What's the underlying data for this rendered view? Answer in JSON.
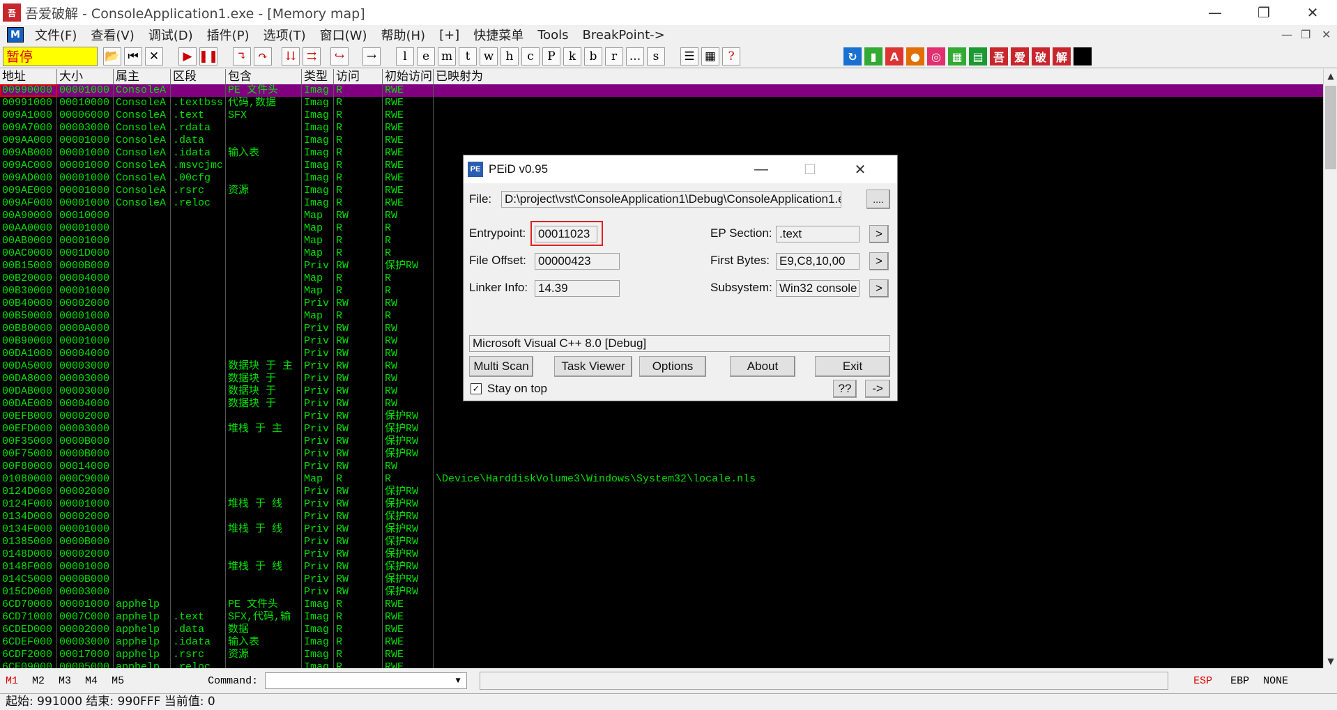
{
  "window": {
    "title": "吾爱破解 - ConsoleApplication1.exe - [Memory map]",
    "app_icon_glyph": "吾"
  },
  "menu": {
    "logo": "M",
    "items": [
      "文件(F)",
      "查看(V)",
      "调试(D)",
      "插件(P)",
      "选项(T)",
      "窗口(W)",
      "帮助(H)",
      "[+]",
      "快捷菜单",
      "Tools",
      "BreakPoint->"
    ]
  },
  "toolbar": {
    "status": "暂停",
    "letters": [
      "l",
      "e",
      "m",
      "t",
      "w",
      "h",
      "c",
      "P",
      "k",
      "b",
      "r",
      "...",
      "s"
    ],
    "chinese_buttons": [
      "吾",
      "爱",
      "破",
      "解"
    ]
  },
  "memory_map": {
    "columns": [
      "地址",
      "大小",
      "属主",
      "区段",
      "包含",
      "类型",
      "访问",
      "初始访问",
      "已映射为"
    ],
    "rows": [
      [
        "00990000",
        "00001000",
        "ConsoleA",
        "",
        "PE 文件头",
        "Imag",
        "R",
        "RWE",
        ""
      ],
      [
        "00991000",
        "00010000",
        "ConsoleA",
        ".textbss",
        "代码,数据",
        "Imag",
        "R",
        "RWE",
        ""
      ],
      [
        "009A1000",
        "00006000",
        "ConsoleA",
        ".text",
        "SFX",
        "Imag",
        "R",
        "RWE",
        ""
      ],
      [
        "009A7000",
        "00003000",
        "ConsoleA",
        ".rdata",
        "",
        "Imag",
        "R",
        "RWE",
        ""
      ],
      [
        "009AA000",
        "00001000",
        "ConsoleA",
        ".data",
        "",
        "Imag",
        "R",
        "RWE",
        ""
      ],
      [
        "009AB000",
        "00001000",
        "ConsoleA",
        ".idata",
        "输入表",
        "Imag",
        "R",
        "RWE",
        ""
      ],
      [
        "009AC000",
        "00001000",
        "ConsoleA",
        ".msvcjmc",
        "",
        "Imag",
        "R",
        "RWE",
        ""
      ],
      [
        "009AD000",
        "00001000",
        "ConsoleA",
        ".00cfg",
        "",
        "Imag",
        "R",
        "RWE",
        ""
      ],
      [
        "009AE000",
        "00001000",
        "ConsoleA",
        ".rsrc",
        "资源",
        "Imag",
        "R",
        "RWE",
        ""
      ],
      [
        "009AF000",
        "00001000",
        "ConsoleA",
        ".reloc",
        "",
        "Imag",
        "R",
        "RWE",
        ""
      ],
      [
        "00A90000",
        "00010000",
        "",
        "",
        "",
        "Map",
        "RW",
        "RW",
        ""
      ],
      [
        "00AA0000",
        "00001000",
        "",
        "",
        "",
        "Map",
        "R",
        "R",
        ""
      ],
      [
        "00AB0000",
        "00001000",
        "",
        "",
        "",
        "Map",
        "R",
        "R",
        ""
      ],
      [
        "00AC0000",
        "0001D000",
        "",
        "",
        "",
        "Map",
        "R",
        "R",
        ""
      ],
      [
        "00B15000",
        "0000B000",
        "",
        "",
        "",
        "Priv",
        "RW",
        "保护RW",
        ""
      ],
      [
        "00B20000",
        "00004000",
        "",
        "",
        "",
        "Map",
        "R",
        "R",
        ""
      ],
      [
        "00B30000",
        "00001000",
        "",
        "",
        "",
        "Map",
        "R",
        "R",
        ""
      ],
      [
        "00B40000",
        "00002000",
        "",
        "",
        "",
        "Priv",
        "RW",
        "RW",
        ""
      ],
      [
        "00B50000",
        "00001000",
        "",
        "",
        "",
        "Map",
        "R",
        "R",
        ""
      ],
      [
        "00B80000",
        "0000A000",
        "",
        "",
        "",
        "Priv",
        "RW",
        "RW",
        ""
      ],
      [
        "00B90000",
        "00001000",
        "",
        "",
        "",
        "Priv",
        "RW",
        "RW",
        ""
      ],
      [
        "00DA1000",
        "00004000",
        "",
        "",
        "",
        "Priv",
        "RW",
        "RW",
        ""
      ],
      [
        "00DA5000",
        "00003000",
        "",
        "",
        "数据块 于 主",
        "Priv",
        "RW",
        "RW",
        ""
      ],
      [
        "00DA8000",
        "00003000",
        "",
        "",
        "数据块 于",
        "Priv",
        "RW",
        "RW",
        ""
      ],
      [
        "00DAB000",
        "00003000",
        "",
        "",
        "数据块 于",
        "Priv",
        "RW",
        "RW",
        ""
      ],
      [
        "00DAE000",
        "00004000",
        "",
        "",
        "数据块 于",
        "Priv",
        "RW",
        "RW",
        ""
      ],
      [
        "00EFB000",
        "00002000",
        "",
        "",
        "",
        "Priv",
        "RW",
        "保护RW",
        ""
      ],
      [
        "00EFD000",
        "00003000",
        "",
        "",
        "堆栈 于 主",
        "Priv",
        "RW",
        "保护RW",
        ""
      ],
      [
        "00F35000",
        "0000B000",
        "",
        "",
        "",
        "Priv",
        "RW",
        "保护RW",
        ""
      ],
      [
        "00F75000",
        "0000B000",
        "",
        "",
        "",
        "Priv",
        "RW",
        "保护RW",
        ""
      ],
      [
        "00F80000",
        "00014000",
        "",
        "",
        "",
        "Priv",
        "RW",
        "RW",
        ""
      ],
      [
        "01080000",
        "000C9000",
        "",
        "",
        "",
        "Map",
        "R",
        "R",
        "\\Device\\HarddiskVolume3\\Windows\\System32\\locale.nls"
      ],
      [
        "0124D000",
        "00002000",
        "",
        "",
        "",
        "Priv",
        "RW",
        "保护RW",
        ""
      ],
      [
        "0124F000",
        "00001000",
        "",
        "",
        "堆栈 于 线",
        "Priv",
        "RW",
        "保护RW",
        ""
      ],
      [
        "0134D000",
        "00002000",
        "",
        "",
        "",
        "Priv",
        "RW",
        "保护RW",
        ""
      ],
      [
        "0134F000",
        "00001000",
        "",
        "",
        "堆栈 于 线",
        "Priv",
        "RW",
        "保护RW",
        ""
      ],
      [
        "01385000",
        "0000B000",
        "",
        "",
        "",
        "Priv",
        "RW",
        "保护RW",
        ""
      ],
      [
        "0148D000",
        "00002000",
        "",
        "",
        "",
        "Priv",
        "RW",
        "保护RW",
        ""
      ],
      [
        "0148F000",
        "00001000",
        "",
        "",
        "堆栈 于 线",
        "Priv",
        "RW",
        "保护RW",
        ""
      ],
      [
        "014C5000",
        "0000B000",
        "",
        "",
        "",
        "Priv",
        "RW",
        "保护RW",
        ""
      ],
      [
        "015CD000",
        "00003000",
        "",
        "",
        "",
        "Priv",
        "RW",
        "保护RW",
        ""
      ],
      [
        "6CD70000",
        "00001000",
        "apphelp",
        "",
        "PE 文件头",
        "Imag",
        "R",
        "RWE",
        ""
      ],
      [
        "6CD71000",
        "0007C000",
        "apphelp",
        ".text",
        "SFX,代码,输",
        "Imag",
        "R",
        "RWE",
        ""
      ],
      [
        "6CDED000",
        "00002000",
        "apphelp",
        ".data",
        "数据",
        "Imag",
        "R",
        "RWE",
        ""
      ],
      [
        "6CDEF000",
        "00003000",
        "apphelp",
        ".idata",
        "输入表",
        "Imag",
        "R",
        "RWE",
        ""
      ],
      [
        "6CDF2000",
        "00017000",
        "apphelp",
        ".rsrc",
        "资源",
        "Imag",
        "R",
        "RWE",
        ""
      ],
      [
        "6CE09000",
        "00005000",
        "apphelp",
        ".reloc",
        "",
        "Imag",
        "R",
        "RWE",
        ""
      ]
    ]
  },
  "command_bar": {
    "tabs": [
      "M1",
      "M2",
      "M3",
      "M4",
      "M5"
    ],
    "label": "Command:",
    "registers": [
      "ESP",
      "EBP",
      "NONE"
    ]
  },
  "status_bar": "起始: 991000 结束: 990FFF 当前值: 0",
  "peid": {
    "title": "PEiD v0.95",
    "file_label": "File:",
    "file_value": "D:\\project\\vst\\ConsoleApplication1\\Debug\\ConsoleApplication1.exe",
    "browse": "....",
    "entrypoint_label": "Entrypoint:",
    "entrypoint": "00011023",
    "file_offset_label": "File Offset:",
    "file_offset": "00000423",
    "linker_label": "Linker Info:",
    "linker": "14.39",
    "ep_section_label": "EP Section:",
    "ep_section": ".text",
    "first_bytes_label": "First Bytes:",
    "first_bytes": "E9,C8,10,00",
    "subsystem_label": "Subsystem:",
    "subsystem": "Win32 console",
    "arrow": ">",
    "detection": "Microsoft Visual C++ 8.0 [Debug]",
    "buttons": [
      "Multi Scan",
      "Task Viewer",
      "Options",
      "About",
      "Exit"
    ],
    "stay_on_top": "Stay on top",
    "qq": "??",
    "next": "->"
  }
}
